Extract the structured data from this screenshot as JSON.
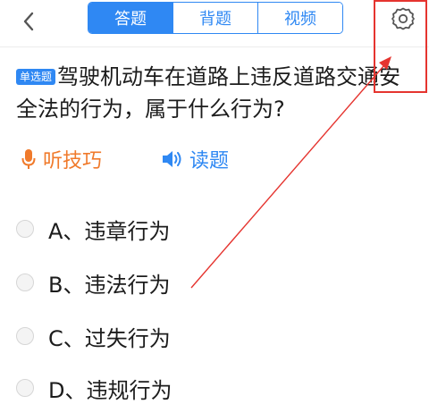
{
  "header": {
    "back_icon": "chevron-left-icon",
    "tabs": [
      {
        "label": "答题",
        "active": true
      },
      {
        "label": "背题",
        "active": false
      },
      {
        "label": "视频",
        "active": false
      }
    ],
    "settings_icon": "gear-icon"
  },
  "question": {
    "type_badge": "单选题",
    "text": "驾驶机动车在道路上违反道路交通安全法的行为，属于什么行为?"
  },
  "tools": {
    "tips_label": "听技巧",
    "tips_icon": "microphone-icon",
    "read_label": "读题",
    "read_icon": "speaker-icon"
  },
  "options": [
    {
      "label": "A、违章行为"
    },
    {
      "label": "B、违法行为"
    },
    {
      "label": "C、过失行为"
    },
    {
      "label": "D、违规行为"
    }
  ],
  "colors": {
    "accent": "#2f88f3",
    "tips": "#f07a2b",
    "annotation": "#e5342f"
  }
}
